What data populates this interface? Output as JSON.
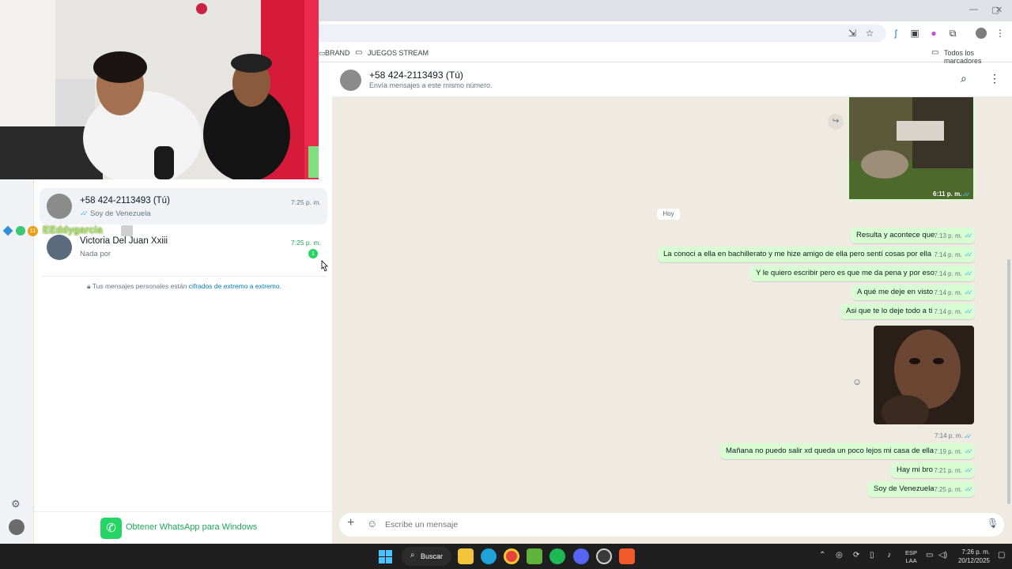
{
  "browser": {
    "bookmarks": [
      "BRAND",
      "JUEGOS STREAM"
    ],
    "bookmarks_right": "Todos los marcadores",
    "window_controls": [
      "—",
      "▢",
      "✕"
    ]
  },
  "stream_overlay": {
    "username": "EEddygarcia",
    "badge_number": "11"
  },
  "sidebar": {
    "chats": [
      {
        "name": "+58 424-2113493 (Tú)",
        "time": "7:25 p. m.",
        "preview": "Soy de Venezuela",
        "ticks": "✓✓"
      },
      {
        "name": "Victoria Del Juan Xxiii",
        "time": "7:25 p. m.",
        "preview": "Nada por",
        "unread": "1"
      }
    ],
    "encryption_notice_prefix": "Tus mensajes personales están ",
    "encryption_notice_link": "cifrados de extremo a extremo",
    "encryption_notice_suffix": ".",
    "get_windows": "Obtener WhatsApp para Windows"
  },
  "chat": {
    "title": "+58 424-2113493 (Tú)",
    "subtitle": "Envía mensajes a este mismo número.",
    "image1_time": "6:11 p. m.",
    "date_chip": "Hoy",
    "messages": [
      {
        "text": "Resulta y acontece que",
        "time": "7:13 p. m."
      },
      {
        "text": "La conoci a ella  en bachillerato y me hize amigo de ella pero sentí cosas por ella",
        "time": "7:14 p. m."
      },
      {
        "text": "Y le quiero escribir pero es que me da pena y por eso",
        "time": "7:14 p. m."
      },
      {
        "text": "A qué me deje en visto",
        "time": "7:14 p. m."
      },
      {
        "text": "Asi que te lo deje todo a ti",
        "time": "7:14 p. m."
      },
      {
        "text": "Mañana no puedo salir xd queda un poco lejos mi casa de ella",
        "time": "7:19 p. m."
      },
      {
        "text": "Hay mi bro",
        "time": "7:21 p. m."
      },
      {
        "text": "Soy de Venezuela",
        "time": "7:25 p. m."
      }
    ],
    "image2_time": "7:14 p. m.",
    "ticks": "✓✓",
    "composer_placeholder": "Escribe un mensaje"
  },
  "taskbar": {
    "search_label": "Buscar",
    "lang_top": "ESP",
    "lang_bottom": "LAA",
    "clock_time": "7:26 p. m.",
    "clock_date": "20/12/2025"
  },
  "colors": {
    "accent": "#25d366",
    "bubble_out": "#d9fdd3",
    "chat_bg": "#efeae2",
    "ticks": "#53bdeb",
    "link": "#027eb5"
  }
}
